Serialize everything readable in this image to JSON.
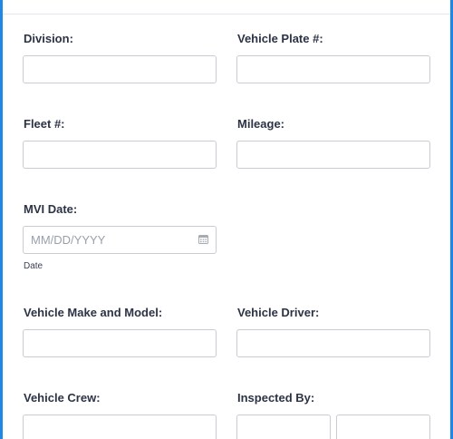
{
  "form": {
    "division_label": "Division:",
    "vehicle_plate_label": "Vehicle Plate #:",
    "fleet_label": "Fleet #:",
    "mileage_label": "Mileage:",
    "mvi_date_label": "MVI Date:",
    "mvi_date_placeholder": "MM/DD/YYYY",
    "mvi_date_sublabel": "Date",
    "make_model_label": "Vehicle Make and Model:",
    "driver_label": "Vehicle Driver:",
    "crew_label": "Vehicle Crew:",
    "inspected_by_label": "Inspected By:"
  },
  "colors": {
    "accent": "#1f87e5",
    "label_text": "#2c3345",
    "input_border": "#c9ccd3",
    "placeholder": "#9aa0ab"
  },
  "icons": {
    "date_picker": "calendar-icon"
  }
}
